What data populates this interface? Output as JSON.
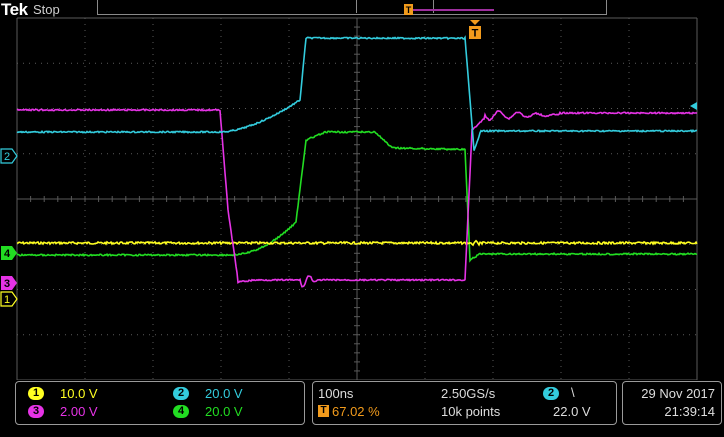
{
  "header": {
    "brand": "Tek",
    "state": "Stop"
  },
  "colors": {
    "ch1": "#ffff22",
    "ch2": "#33ccdd",
    "ch3": "#e633e6",
    "ch4": "#22dd22",
    "trigger": "#f29b1c",
    "grid": "#5a5a5a"
  },
  "markers": {
    "ch1": "1",
    "ch2": "2",
    "ch3": "3",
    "ch4": "4",
    "trigger": "T"
  },
  "channels": [
    {
      "num": "1",
      "scale": "10.0 V"
    },
    {
      "num": "2",
      "scale": "20.0 V"
    },
    {
      "num": "3",
      "scale": "2.00 V"
    },
    {
      "num": "4",
      "scale": "20.0 V"
    }
  ],
  "horizontal": {
    "time_div": "100ns",
    "sample_rate": "2.50GS/s",
    "record_length": "10k points",
    "trigger_pos": "67.02 %"
  },
  "trigger": {
    "source": "2",
    "slope": "\\",
    "level": "22.0 V"
  },
  "datetime": {
    "date": "29 Nov 2017",
    "time": "21:39:14"
  }
}
